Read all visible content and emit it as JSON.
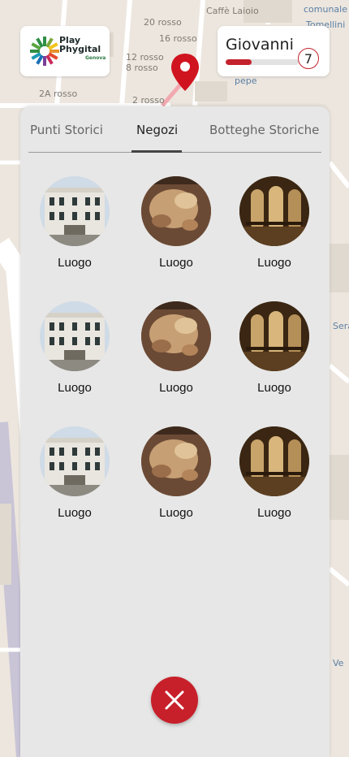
{
  "map": {
    "labels": [
      {
        "text": "Caffè Laioio",
        "cls": ""
      },
      {
        "text": "comunale",
        "cls": "blue"
      },
      {
        "text": "20 rosso",
        "cls": ""
      },
      {
        "text": "Tomellini",
        "cls": "blue"
      },
      {
        "text": "16 rosso",
        "cls": ""
      },
      {
        "text": "12 rosso",
        "cls": ""
      },
      {
        "text": "8 rosso",
        "cls": ""
      },
      {
        "text": "2A rosso",
        "cls": ""
      },
      {
        "text": "2 rosso",
        "cls": ""
      },
      {
        "text": "pepe",
        "cls": "blue"
      },
      {
        "text": "Sera",
        "cls": "blue"
      },
      {
        "text": "Ve",
        "cls": "blue"
      }
    ]
  },
  "logo": {
    "line1": "Play",
    "line2": "Phygital",
    "sub": "Genova",
    "colors": [
      "#2f8f46",
      "#f0c419",
      "#e3492b",
      "#1c6fb5",
      "#7b3f98"
    ]
  },
  "user": {
    "name": "Giovanni",
    "level": "7",
    "progress_percent": 35,
    "accent_color": "#c4222c"
  },
  "panel": {
    "tabs": [
      {
        "label": "Punti Storici",
        "active": false
      },
      {
        "label": "Negozi",
        "active": true
      },
      {
        "label": "Botteghe Storiche",
        "active": false
      }
    ],
    "items": [
      {
        "label": "Luogo",
        "image": "palazzo-facade"
      },
      {
        "label": "Luogo",
        "image": "ceiling-fresco"
      },
      {
        "label": "Luogo",
        "image": "arcade-loggia"
      },
      {
        "label": "Luogo",
        "image": "palazzo-facade"
      },
      {
        "label": "Luogo",
        "image": "ceiling-fresco"
      },
      {
        "label": "Luogo",
        "image": "arcade-loggia"
      },
      {
        "label": "Luogo",
        "image": "palazzo-facade"
      },
      {
        "label": "Luogo",
        "image": "ceiling-fresco"
      },
      {
        "label": "Luogo",
        "image": "arcade-loggia"
      }
    ],
    "close_icon": "close-icon",
    "close_color": "#c7202a"
  }
}
